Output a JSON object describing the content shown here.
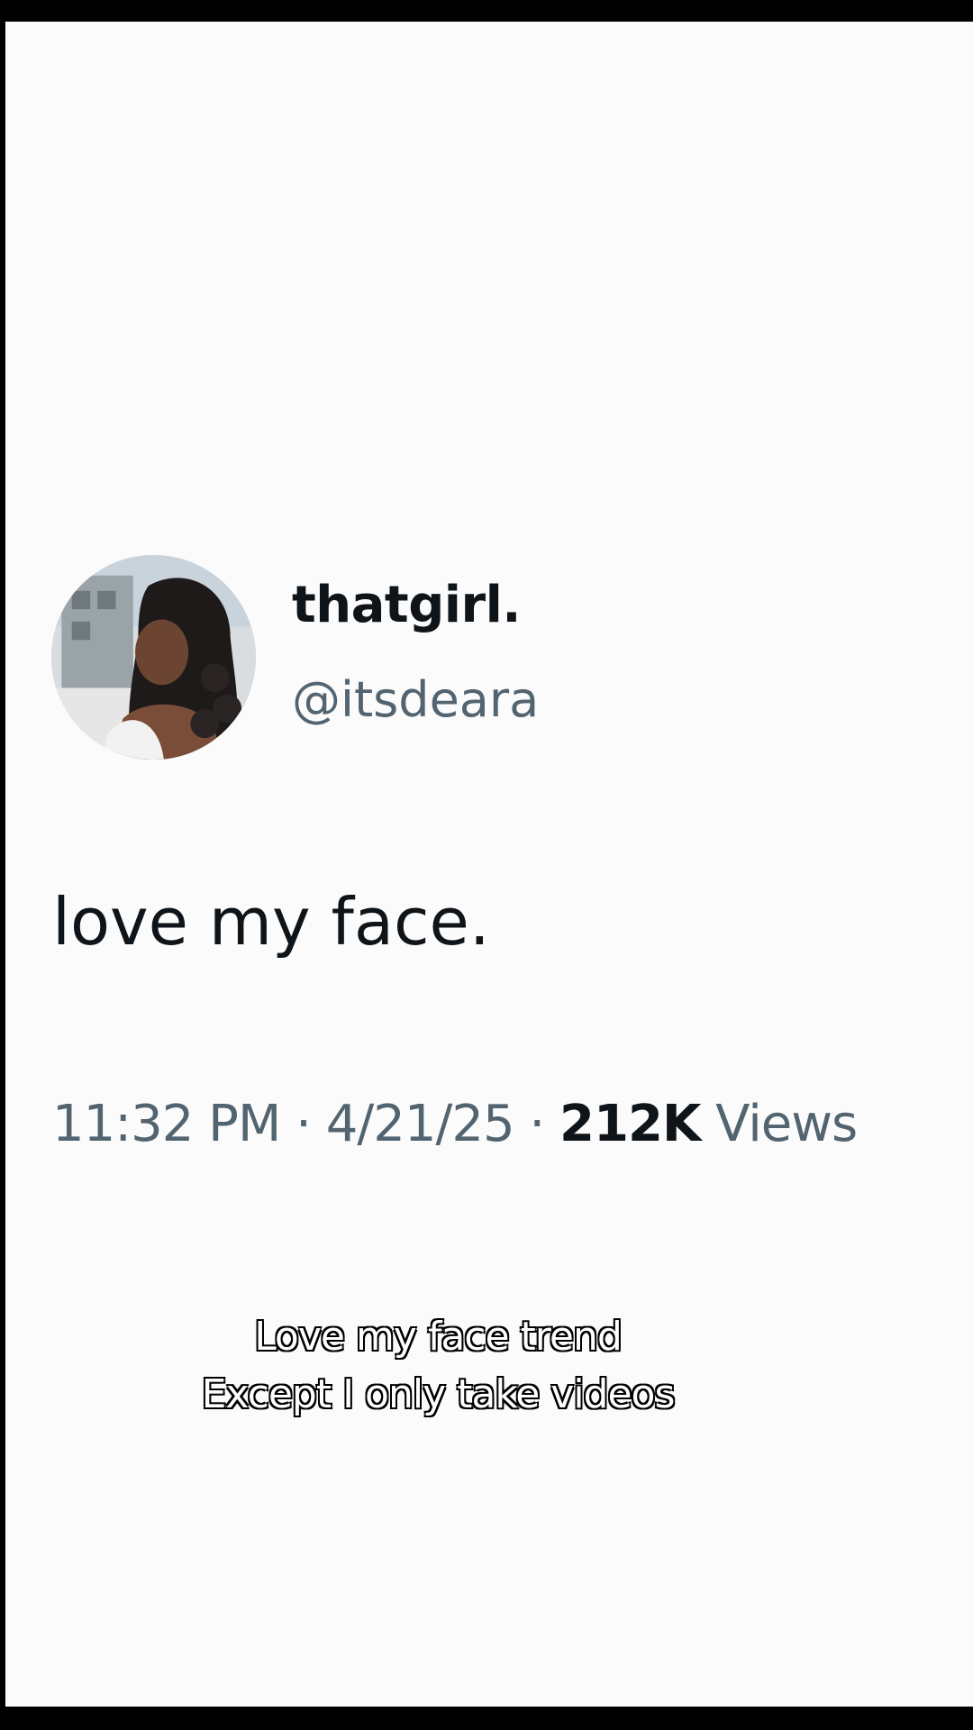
{
  "tweet": {
    "display_name": "thatgirl.",
    "handle": "@itsdeara",
    "text": "love my face.",
    "time": "11:32 PM",
    "separator": "·",
    "date": "4/21/25",
    "views_count": "212K",
    "views_label": "Views"
  },
  "caption": {
    "line1": "Love my face trend",
    "line2": "Except I only take videos"
  },
  "colors": {
    "background": "#fbfbfb",
    "primary_text": "#0f1419",
    "secondary_text": "#536471"
  }
}
